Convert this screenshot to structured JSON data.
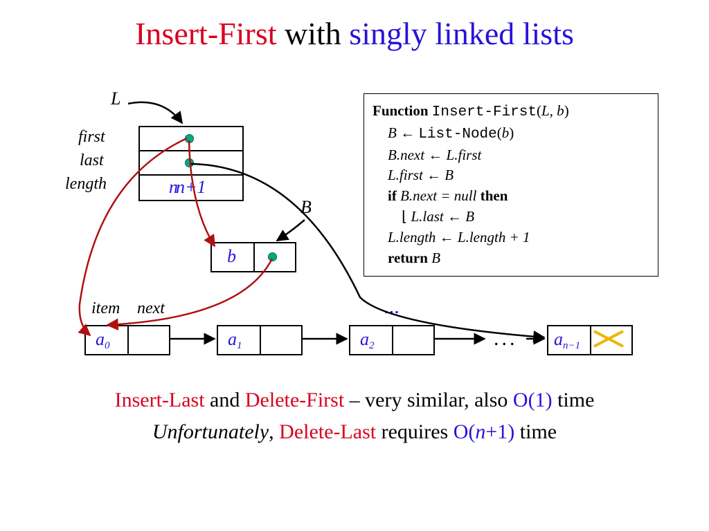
{
  "title": {
    "p1": "Insert-First",
    "p2": " with ",
    "p3": "singly linked lists"
  },
  "labels": {
    "L": "L",
    "first": "first",
    "last": "last",
    "length": "length",
    "B": "B",
    "b": "b",
    "item": "item",
    "next": "next",
    "lenval": "n+1",
    "lenvalOld": "n",
    "dots": "...",
    "dotsblue": "..."
  },
  "nodes": {
    "a0": "a",
    "a0s": "0",
    "a1": "a",
    "a1s": "1",
    "a2": "a",
    "a2s": "2",
    "an": "a",
    "ans": "n−1"
  },
  "code": {
    "l1a": "Function ",
    "l1b": "Insert-First",
    "l1c": "(",
    "l1d": "L, b",
    "l1e": ")",
    "l2a": "B ← ",
    "l2b": "List-Node",
    "l2c": "(",
    "l2d": "b",
    "l2e": ")",
    "l3": "B.next ← L.first",
    "l4": "L.first ← B",
    "l5a": "if",
    "l5b": "  B.next = null ",
    "l5c": "then",
    "l6a": "⌊  ",
    "l6b": "L.last ← B",
    "l7": "L.length ← L.length + 1",
    "l8a": "return ",
    "l8b": "B"
  },
  "bottom1": {
    "a": "Insert-Last",
    "b": " and ",
    "c": "Delete-First",
    "d": " – very similar, also ",
    "e": "O(1)",
    "f": " time"
  },
  "bottom2": {
    "a": "Unfortunately",
    "b": ", ",
    "c": "Delete-Last",
    "d": " requires ",
    "e": "O(",
    "f": "n",
    "g": "+1)",
    "h": " time"
  }
}
